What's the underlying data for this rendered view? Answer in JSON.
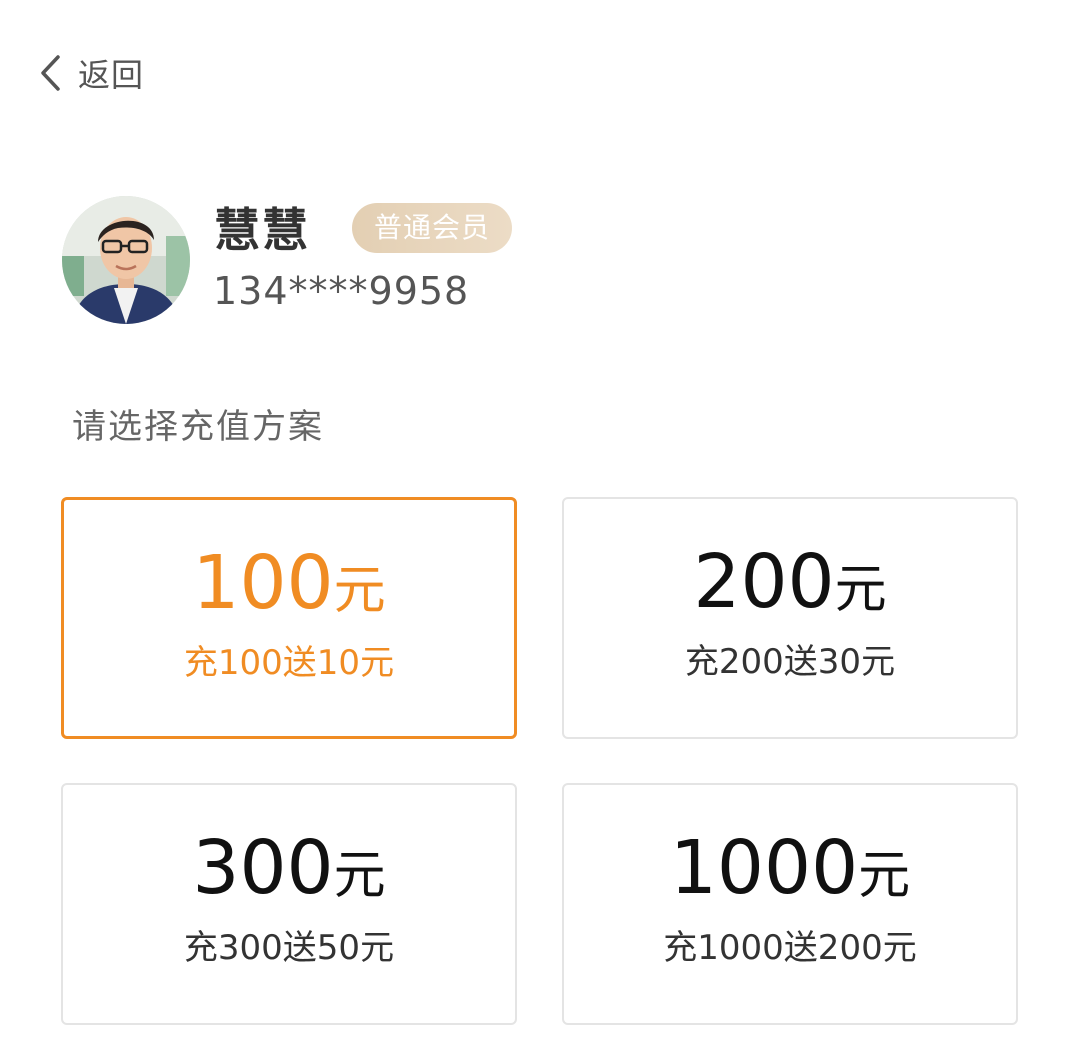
{
  "header": {
    "back_label": "返回",
    "back_icon": "chevron-left-icon"
  },
  "user": {
    "name": "慧慧",
    "badge": "普通会员",
    "phone": "134****9958"
  },
  "section_title": "请选择充值方案",
  "plans": [
    {
      "amount": "100",
      "unit": "元",
      "bonus": "充100送10元",
      "selected": true
    },
    {
      "amount": "200",
      "unit": "元",
      "bonus": "充200送30元",
      "selected": false
    },
    {
      "amount": "300",
      "unit": "元",
      "bonus": "充300送50元",
      "selected": false
    },
    {
      "amount": "1000",
      "unit": "元",
      "bonus": "充1000送200元",
      "selected": false
    }
  ],
  "colors": {
    "accent": "#f08c23",
    "badge_bg": "#e6d3b8",
    "border": "#e4e4e4"
  }
}
